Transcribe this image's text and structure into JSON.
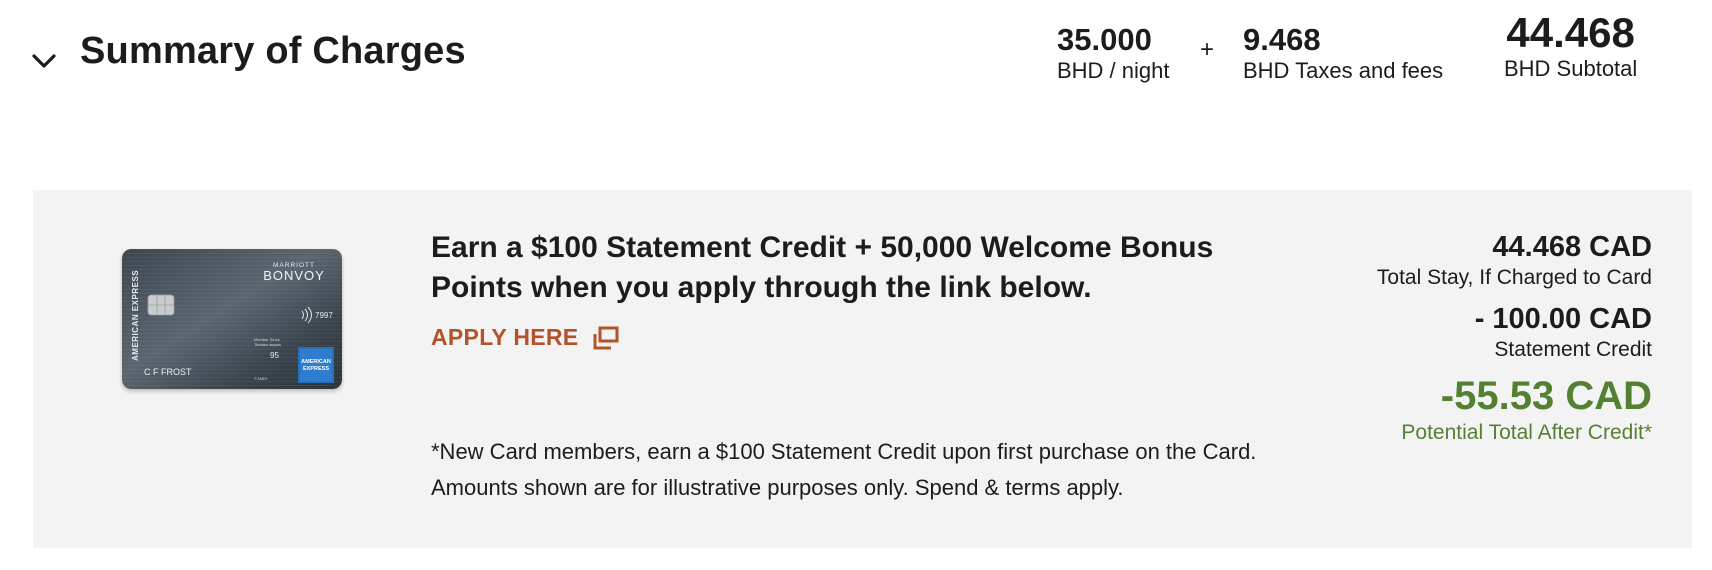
{
  "summary": {
    "title": "Summary of Charges",
    "nightly_rate": {
      "value": "35.000",
      "label": "BHD / night"
    },
    "plus": "+",
    "taxes": {
      "value": "9.468",
      "label": "BHD Taxes and fees"
    },
    "subtotal": {
      "value": "44.468",
      "label": "BHD Subtotal"
    }
  },
  "promo": {
    "card": {
      "brand": "MARRIOTT",
      "product": "BONVOY",
      "issuer": "AMERICAN EXPRESS",
      "holder": "C F FROST",
      "last_digits": "7997",
      "expiry": "95",
      "logo_line1": "AMERICAN",
      "logo_line2": "EXPRESS",
      "member_line1": "Member Since",
      "member_line2": "Titulaire depuis",
      "footer": "© AMEX"
    },
    "headline": "Earn a $100 Statement Credit + 50,000 Welcome Bonus Points when you apply through the link below.",
    "apply_label": "APPLY HERE",
    "apply_icon": "external-window-icon",
    "disclaimer": "*New Card members, earn a $100 Statement Credit upon first purchase on the Card. Amounts shown are for illustrative purposes only. Spend & terms apply.",
    "total_stay": {
      "value": "44.468 CAD",
      "label": "Total Stay, If Charged to Card"
    },
    "statement_credit": {
      "value": "- 100.00 CAD",
      "label": "Statement Credit"
    },
    "after_credit": {
      "value": "-55.53 CAD",
      "label": "Potential Total After Credit*"
    }
  },
  "colors": {
    "link": "#b2532a",
    "positive": "#548033",
    "panel_bg": "#f3f3f3"
  }
}
